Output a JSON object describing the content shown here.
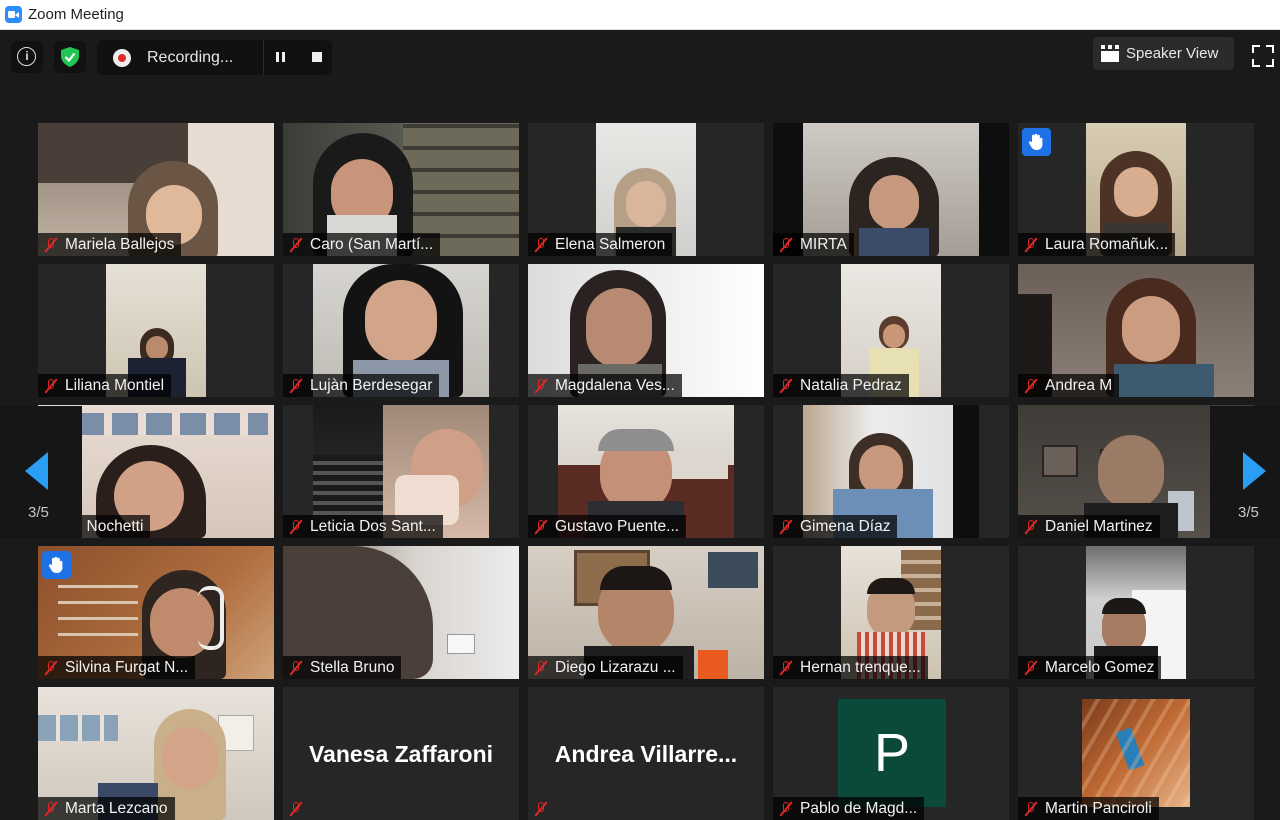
{
  "window": {
    "title": "Zoom Meeting"
  },
  "toolbar": {
    "recording_label": "Recording...",
    "speaker_view_label": "Speaker View",
    "info_glyph": "i"
  },
  "pagination": {
    "current": "3/5"
  },
  "participants": [
    {
      "name": "Mariela Ballejos",
      "muted": true,
      "hand": false
    },
    {
      "name": "Caro (San Martí...",
      "muted": true,
      "hand": false
    },
    {
      "name": "Elena Salmeron",
      "muted": true,
      "hand": false
    },
    {
      "name": "MIRTA",
      "muted": true,
      "hand": false
    },
    {
      "name": "Laura Romañuk...",
      "muted": true,
      "hand": true
    },
    {
      "name": "Liliana Montiel",
      "muted": true,
      "hand": false
    },
    {
      "name": "Lujàn Berdesegar",
      "muted": true,
      "hand": false
    },
    {
      "name": "Magdalena Ves...",
      "muted": true,
      "hand": false
    },
    {
      "name": "Natalia Pedraz",
      "muted": true,
      "hand": false
    },
    {
      "name": "Andrea M",
      "muted": true,
      "hand": false
    },
    {
      "name": "bo Nochetti",
      "muted": false,
      "hand": false
    },
    {
      "name": "Leticia Dos Sant...",
      "muted": true,
      "hand": false
    },
    {
      "name": "Gustavo Puente...",
      "muted": true,
      "hand": false
    },
    {
      "name": "Gimena Díaz",
      "muted": true,
      "hand": false
    },
    {
      "name": "Daniel Martinez",
      "muted": true,
      "hand": false
    },
    {
      "name": "Silvina Furgat N...",
      "muted": true,
      "hand": true
    },
    {
      "name": "Stella Bruno",
      "muted": true,
      "hand": false
    },
    {
      "name": "Diego Lizarazu ...",
      "muted": true,
      "hand": false
    },
    {
      "name": "Hernan trenque...",
      "muted": true,
      "hand": false
    },
    {
      "name": "Marcelo Gomez",
      "muted": true,
      "hand": false
    },
    {
      "name": "Marta Lezcano",
      "muted": true,
      "hand": false
    },
    {
      "name": "Vanesa Zaffaroni",
      "muted": true,
      "hand": false
    },
    {
      "name": "Andrea  Villarre...",
      "muted": true,
      "hand": false
    },
    {
      "name": "Pablo de Magd...",
      "muted": true,
      "hand": false,
      "avatar_letter": "P"
    },
    {
      "name": "Martin Panciroli",
      "muted": true,
      "hand": false
    }
  ],
  "colors": {
    "background": "#1a1a1a",
    "tile": "#262626",
    "muted_red": "#e02828",
    "raise_hand_blue": "#1f72e6",
    "nav_arrow_blue": "#2a9df4",
    "avatar_green": "#0b4a3a",
    "shield_green": "#23c552"
  },
  "icons": [
    "zoom-logo-icon",
    "info-icon",
    "shield-check-icon",
    "record-icon",
    "pause-icon",
    "stop-icon",
    "speaker-view-icon",
    "fullscreen-icon",
    "mic-muted-icon",
    "raise-hand-icon",
    "arrow-left-icon",
    "arrow-right-icon"
  ]
}
